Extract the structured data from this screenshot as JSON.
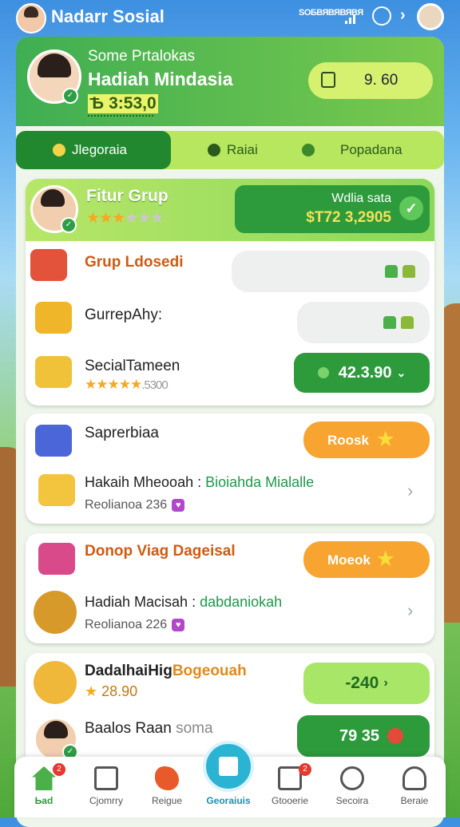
{
  "topbar": {
    "title": "Nadarr Sosial",
    "status_text": "SOБВЯВЯВЯВЯ"
  },
  "profile": {
    "subtitle": "Some Prtalokas",
    "name": "Hadiah Mindasia",
    "id": "Ѣ 3:53,0",
    "balance": "9. 60"
  },
  "tabs": [
    {
      "label": "Jlegoraia"
    },
    {
      "label": "Raiai"
    },
    {
      "label": "Popadana"
    }
  ],
  "featured": {
    "title": "Fitur Grup",
    "rating": 3,
    "rating_max": 6,
    "button_label": "Wdlia sata",
    "button_value": "$T72 3,2905"
  },
  "group_card": {
    "rows": [
      {
        "title": "Grup Ldosedi"
      },
      {
        "title": "GurrepAhy:"
      },
      {
        "title": "SecialTameen",
        "rating": 5,
        "rating_text": ".5300",
        "button_value": "42.3.90"
      }
    ]
  },
  "card2": {
    "rows": [
      {
        "title": "Saprerbiaa",
        "button_label": "Roosk"
      },
      {
        "title": "Hakaih Mheooah :",
        "title_green": "Bioiahda Mialalle",
        "sub": "Reolianoa 236"
      }
    ]
  },
  "card3": {
    "rows": [
      {
        "title": "Donop Viag Dageisal",
        "button_label": "Moeok"
      },
      {
        "title": "Hadiah Macisah :",
        "title_green": "dabdaniokah",
        "sub": "Reolianoa 226"
      }
    ]
  },
  "card4": {
    "rows": [
      {
        "title": "DadalhaiHig",
        "title_orange": "Bogeouah",
        "sub": "28.90",
        "button_value": "-240"
      },
      {
        "title": "Baalos Raan",
        "title_grey": "soma",
        "button_value": "79 35"
      }
    ]
  },
  "bottom_nav": [
    {
      "label": "Ьаd",
      "badge": "2"
    },
    {
      "label": "Cjomrry"
    },
    {
      "label": "Reigue"
    },
    {
      "label": "Georaiuis"
    },
    {
      "label": "Gtooerie",
      "badge": "2"
    },
    {
      "label": "Secoira"
    },
    {
      "label": "Beraie"
    }
  ],
  "colors": {
    "primary_green": "#2d9a3c",
    "lime": "#b7e65f",
    "orange": "#f7a430",
    "sky": "#3d8fe0"
  }
}
